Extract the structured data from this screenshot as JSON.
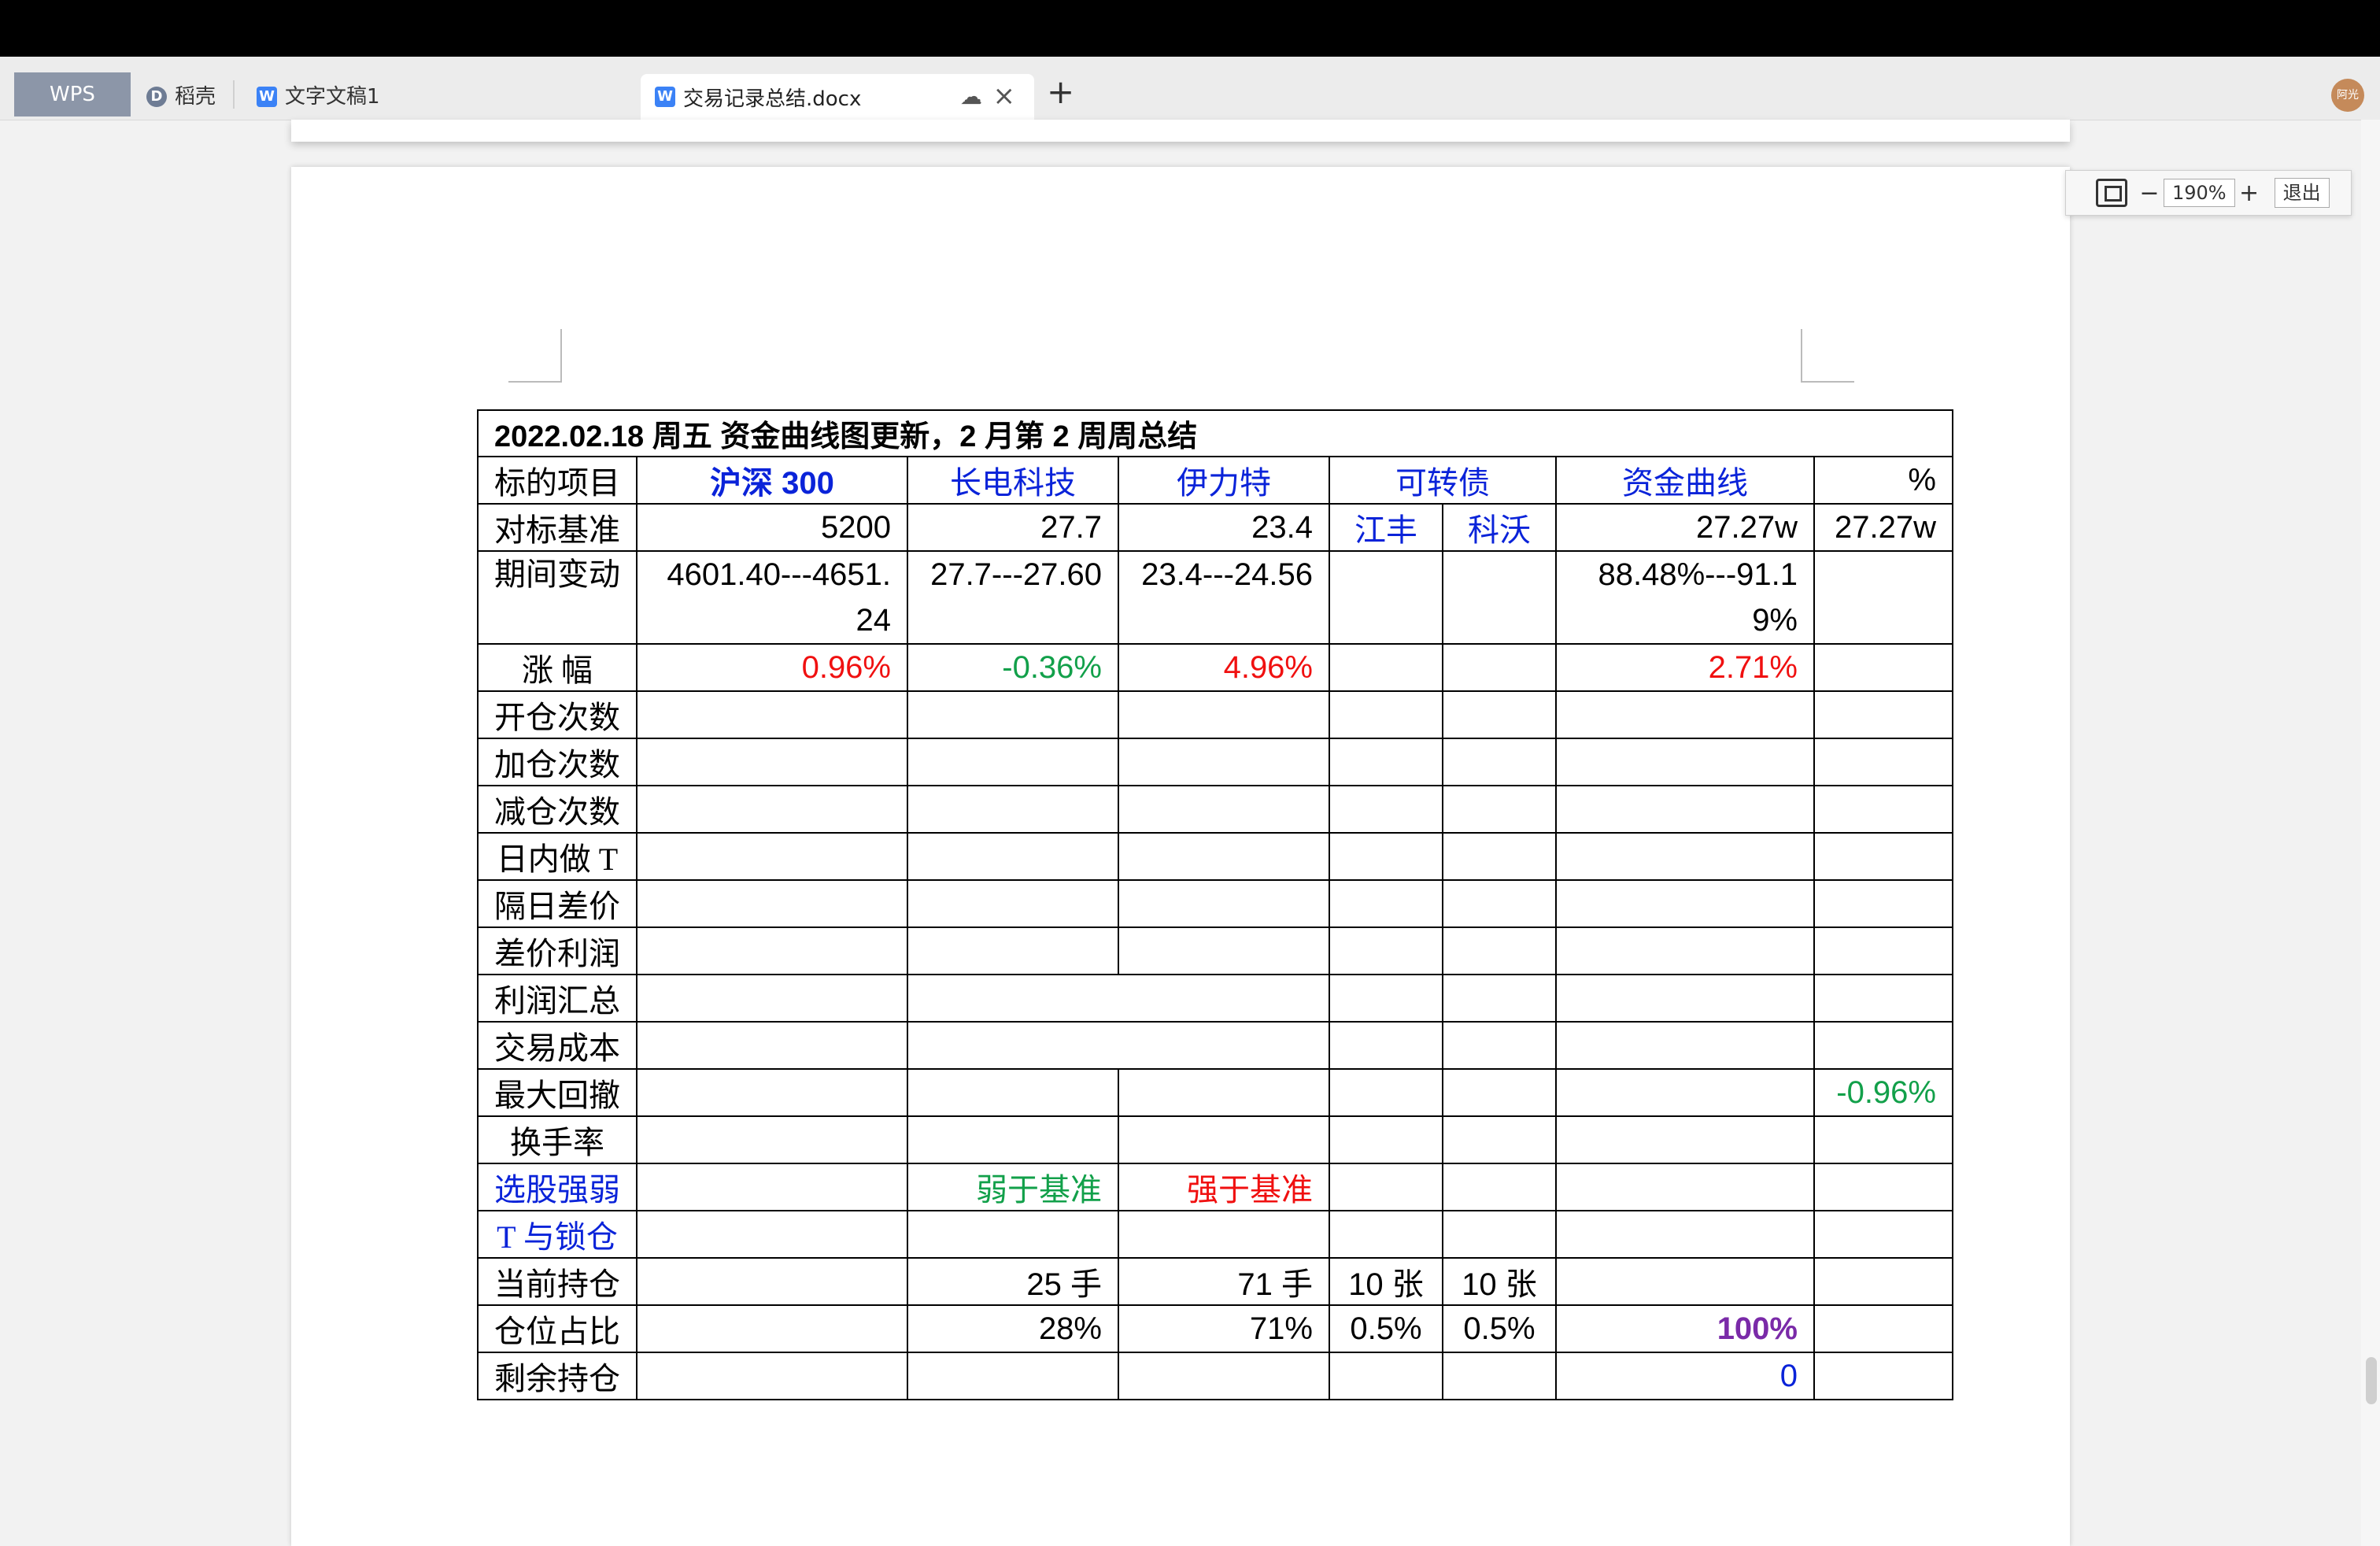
{
  "tabs": {
    "wps": "WPS",
    "daoke": "稻壳",
    "doc1": "文字文稿1",
    "active": "交易记录总结.docx",
    "new_tab": "+",
    "avatar": "阿光"
  },
  "zoom": {
    "level": "190%",
    "minus": "−",
    "plus": "+",
    "exit": "退出"
  },
  "table": {
    "title": "2022.02.18  周五  资金曲线图更新，2 月第 2 周周总结",
    "headers": [
      "标的项目",
      "沪深 300",
      "长电科技",
      "伊力特",
      "可转债",
      "资金曲线",
      "%"
    ],
    "rows": {
      "benchmark": {
        "label": "对标基准",
        "hs300": "5200",
        "cdkj": "27.7",
        "ylt": "23.4",
        "jf": "江丰",
        "kw": "科沃",
        "curve": "27.27w",
        "pct": "27.27w"
      },
      "change": {
        "label": "期间变动",
        "hs300": "4601.40---4651.24",
        "cdkj": "27.7---27.60",
        "ylt": "23.4---24.56",
        "curve": "88.48%---91.19%"
      },
      "gain": {
        "label": "涨  幅",
        "hs300": "0.96%",
        "cdkj": "-0.36%",
        "ylt": "4.96%",
        "curve": "2.71%"
      },
      "open": {
        "label": "开仓次数"
      },
      "add": {
        "label": "加仓次数"
      },
      "reduce": {
        "label": "减仓次数"
      },
      "intraday": {
        "label": "日内做 T"
      },
      "overnight": {
        "label": "隔日差价"
      },
      "spread_profit": {
        "label": "差价利润"
      },
      "profit_total": {
        "label": "利润汇总"
      },
      "cost": {
        "label": "交易成本"
      },
      "drawdown": {
        "label": "最大回撤",
        "pct": "-0.96%"
      },
      "turnover": {
        "label": "换手率"
      },
      "strength": {
        "label": "选股强弱",
        "cdkj": "弱于基准",
        "ylt": "强于基准"
      },
      "t_lock": {
        "label": "T 与锁仓"
      },
      "holding": {
        "label": "当前持仓",
        "cdkj": "25 手",
        "ylt": "71 手",
        "jf": "10 张",
        "kw": "10 张"
      },
      "ratio": {
        "label": "仓位占比",
        "cdkj": "28%",
        "ylt": "71%",
        "jf": "0.5%",
        "kw": "0.5%",
        "curve": "100%"
      },
      "remaining": {
        "label": "剩余持仓",
        "curve": "0"
      }
    }
  },
  "colors": {
    "blue": "#0a23d9",
    "red": "#f01010",
    "green": "#12a04a",
    "purple": "#7a2aa8"
  }
}
